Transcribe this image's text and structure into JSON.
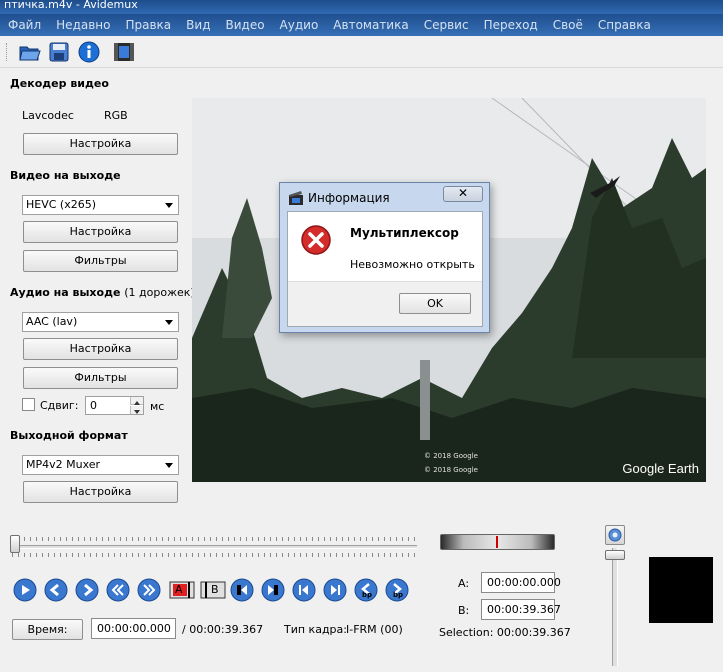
{
  "window": {
    "title": "птичка.m4v - Avidemux"
  },
  "menu": [
    "Файл",
    "Недавно",
    "Правка",
    "Вид",
    "Видео",
    "Аудио",
    "Автоматика",
    "Сервис",
    "Переход",
    "Своё",
    "Справка"
  ],
  "toolbar": {
    "icons": [
      "open-folder-icon",
      "save-disk-icon",
      "info-icon",
      "video-clapper-icon"
    ]
  },
  "decoder": {
    "title": "Декодер видео",
    "codec": "Lavcodec",
    "colorspace": "RGB",
    "settings_label": "Настройка"
  },
  "video_out": {
    "title": "Видео на выходе",
    "codec": "HEVC (x265)",
    "settings_label": "Настройка",
    "filters_label": "Фильтры"
  },
  "audio_out": {
    "title": "Аудио на выходе",
    "tracks": "(1 дорожек)",
    "codec": "AAC (lav)",
    "settings_label": "Настройка",
    "filters_label": "Фильтры",
    "shift_label": "Сдвиг:",
    "shift_value": "0",
    "shift_unit": "мс"
  },
  "output_format": {
    "title": "Выходной формат",
    "muxer": "MP4v2 Muxer",
    "settings_label": "Настройка"
  },
  "video_overlay": {
    "brand": "Google Earth",
    "copyright_1": "© 2018 Google",
    "copyright_2": "© 2018 Google"
  },
  "dialog": {
    "title": "Информация",
    "close": "✕",
    "heading": "Мультиплексор",
    "message": "Невозможно открыть",
    "ok_label": "OK"
  },
  "playback": {
    "time_button": "Время:",
    "current_time": "00:00:00.000",
    "total_time": "/ 00:00:39.367",
    "frame_type_label": "Тип кадра:",
    "frame_type_value": "I-FRM (00)",
    "marker_a_label": "A:",
    "marker_a_value": "00:00:00.000",
    "marker_b_label": "B:",
    "marker_b_value": "00:00:39.367",
    "selection_label": "Selection: 00:00:39.367",
    "mark_a_text": "A",
    "mark_b_text": "B",
    "prev_bp_text": "bp",
    "next_bp_text": "bp"
  },
  "colors": {
    "accent_blue": "#2f6ab3",
    "control_blue": "#3a78d0",
    "error_red": "#d42b2b",
    "jog_marker": "#d00000"
  }
}
